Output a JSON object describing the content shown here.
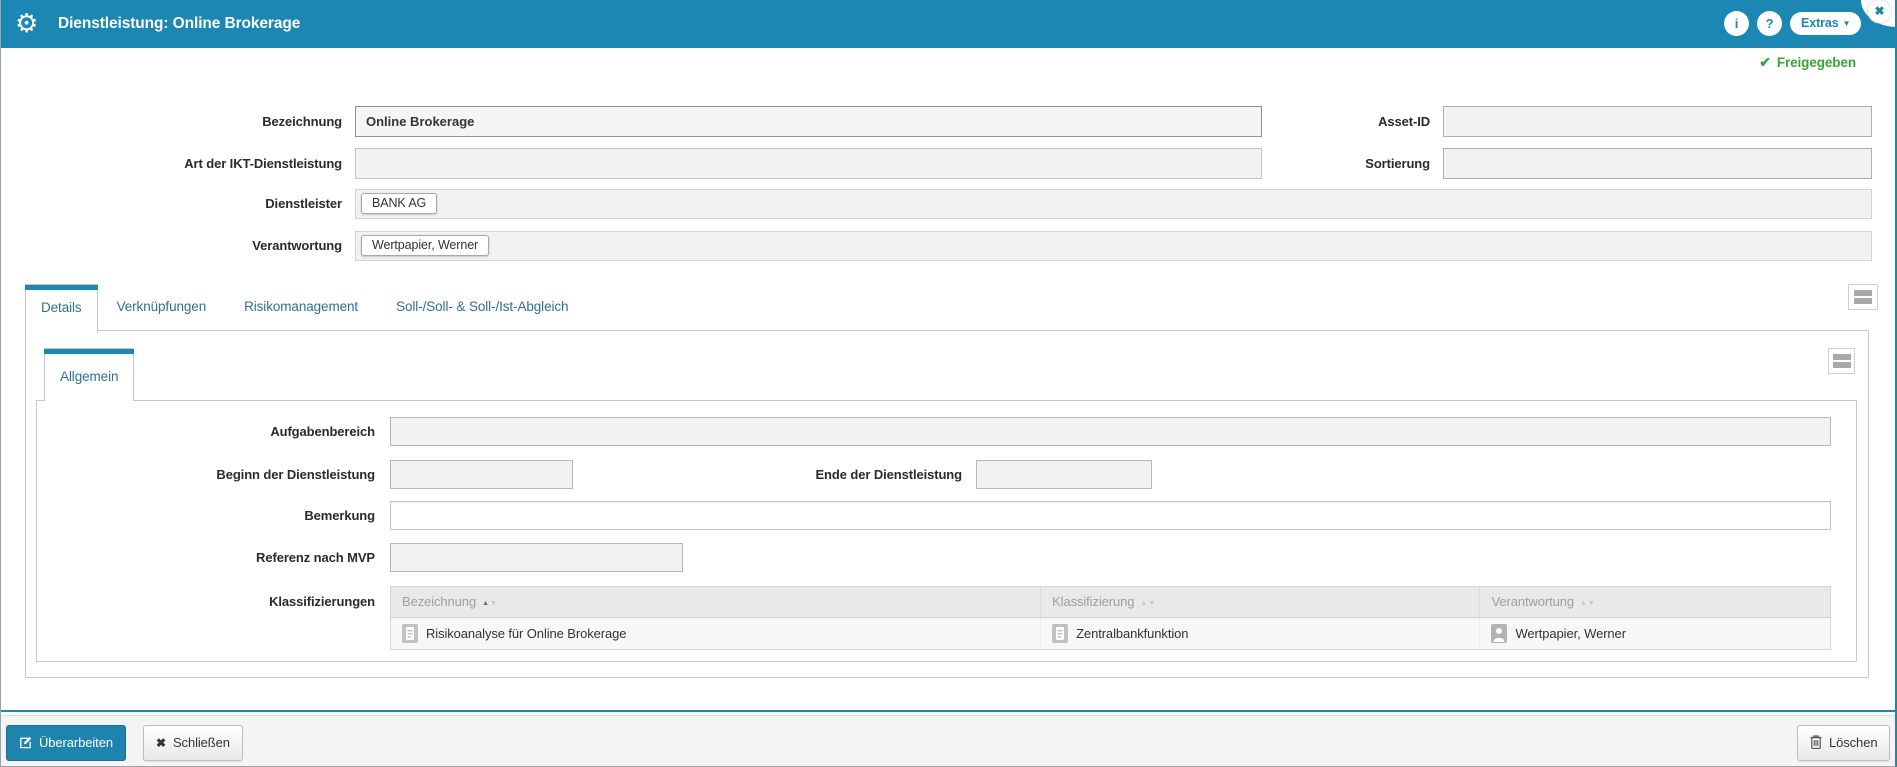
{
  "colors": {
    "accent": "#1d87b4",
    "status_green": "#3aa336"
  },
  "icons": {
    "gear": "⚙",
    "info": "i",
    "help": "?",
    "caret_down": "▼",
    "close": "✖",
    "check": "✔",
    "sort_up": "▲",
    "sort_down": "▼",
    "close_small": "✖"
  },
  "titlebar": {
    "title": "Dienstleistung: Online Brokerage",
    "extras_label": "Extras"
  },
  "status": {
    "label": "Freigegeben"
  },
  "form": {
    "bezeichnung_label": "Bezeichnung",
    "bezeichnung_value": "Online Brokerage",
    "asset_id_label": "Asset-ID",
    "asset_id_value": "",
    "art_ikt_label": "Art der IKT-Dienstleistung",
    "art_ikt_value": "",
    "sortierung_label": "Sortierung",
    "sortierung_value": "",
    "dienstleister_label": "Dienstleister",
    "dienstleister_chip": "BANK AG",
    "verantwortung_label": "Verantwortung",
    "verantwortung_chip": "Wertpapier, Werner"
  },
  "tabs": {
    "active": "Details",
    "items": [
      {
        "label": "Details"
      },
      {
        "label": "Verknüpfungen"
      },
      {
        "label": "Risikomanagement"
      },
      {
        "label": "Soll-/Soll- & Soll-/Ist-Abgleich"
      }
    ]
  },
  "subtabs": {
    "active": "Allgemein",
    "items": [
      {
        "label": "Allgemein"
      }
    ]
  },
  "details": {
    "aufgabenbereich_label": "Aufgabenbereich",
    "aufgabenbereich_value": "",
    "beginn_label": "Beginn der Dienstleistung",
    "beginn_value": "",
    "ende_label": "Ende der Dienstleistung",
    "ende_value": "",
    "bemerkung_label": "Bemerkung",
    "bemerkung_value": "",
    "referenz_label": "Referenz nach MVP",
    "referenz_value": "",
    "klassifizierungen_label": "Klassifizierungen",
    "table": {
      "columns": [
        {
          "label": "Bezeichnung",
          "sorted": "asc"
        },
        {
          "label": "Klassifizierung",
          "sorted": null
        },
        {
          "label": "Verantwortung",
          "sorted": null
        }
      ],
      "rows": [
        {
          "bezeichnung": "Risikoanalyse für Online Brokerage",
          "klassifizierung": "Zentralbankfunktion",
          "verantwortung": "Wertpapier, Werner"
        }
      ]
    }
  },
  "footer": {
    "ueberarbeiten_label": "Überarbeiten",
    "schliessen_label": "Schließen",
    "loeschen_label": "Löschen"
  }
}
